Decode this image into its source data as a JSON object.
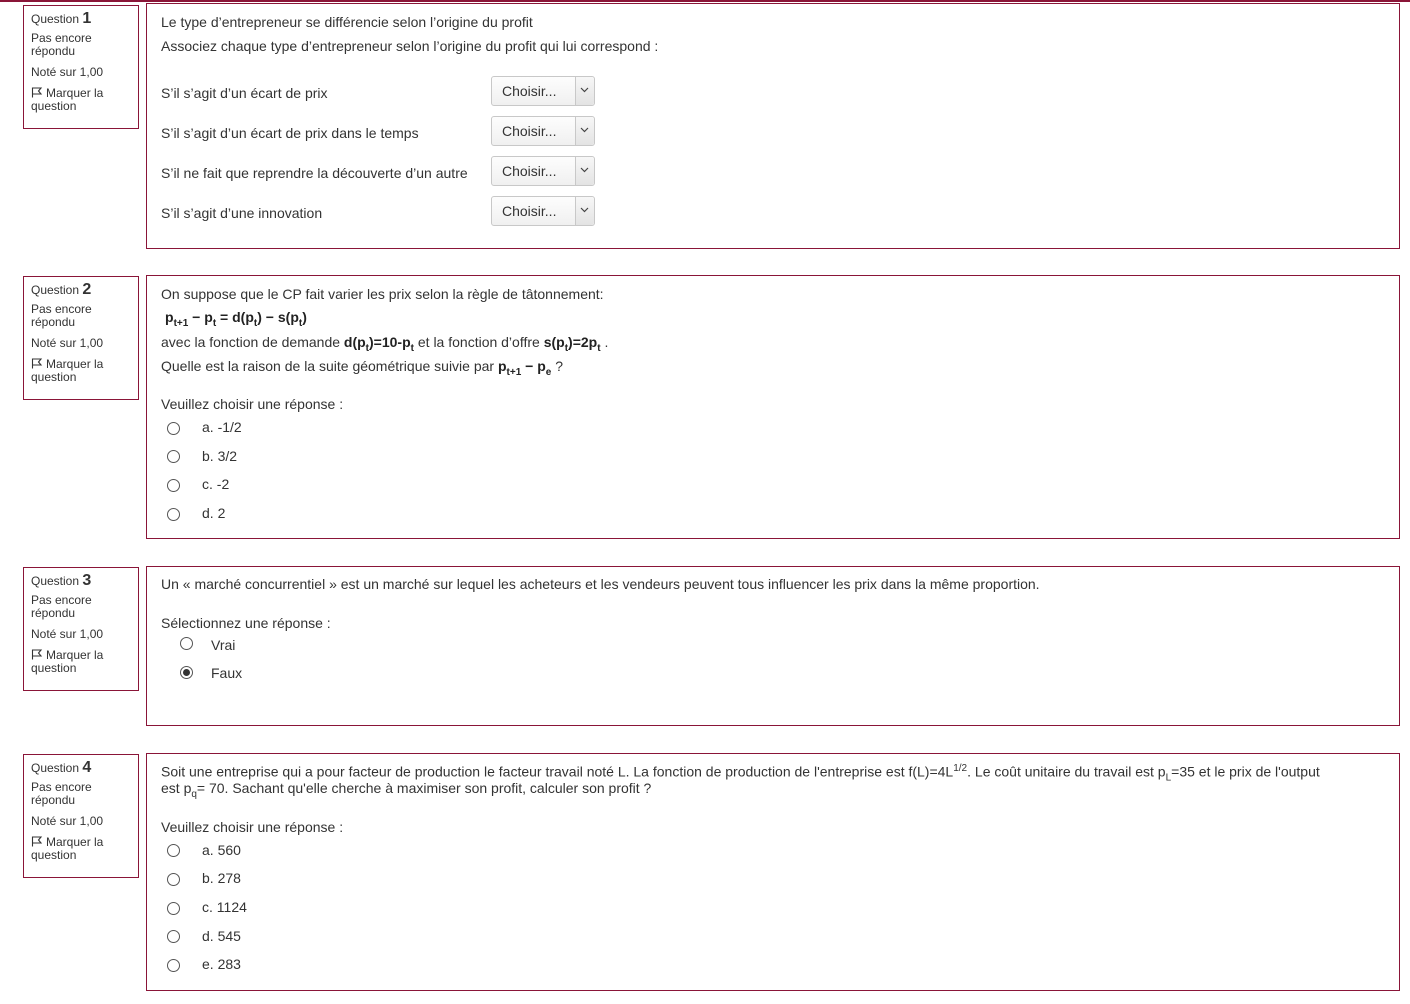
{
  "questions": [
    {
      "label": "Question",
      "number": "1",
      "state": "Pas encore répondu",
      "grade": "Noté sur 1,00",
      "flag_label": "Marquer la question",
      "title": "Le type d’entrepreneur se différencie selon l’origine du profit",
      "prompt": "Associez chaque type d’entrepreneur selon l’origine du profit qui lui correspond :",
      "rows": [
        {
          "label": "S’il s’agit d’un écart de prix",
          "select_value": "Choisir..."
        },
        {
          "label": "S’il s’agit d’un écart de prix dans le temps",
          "select_value": "Choisir..."
        },
        {
          "label": "S’il ne fait que reprendre la découverte d’un autre",
          "select_value": "Choisir..."
        },
        {
          "label": "S’il s’agit d’une innovation",
          "select_value": "Choisir..."
        }
      ]
    },
    {
      "label": "Question",
      "number": "2",
      "state": "Pas encore répondu",
      "grade": "Noté sur 1,00",
      "flag_label": "Marquer la question",
      "intro": "On suppose que le CP fait varier les prix selon la règle de tâtonnement:",
      "formula": {
        "p": "p",
        "t1": "t+1",
        "minus": " − ",
        "t": "t",
        "eq": " = d(p",
        "close": ") − s(p",
        "end": ")"
      },
      "line2": {
        "a": "avec la fonction de demande ",
        "demand": "d(p",
        "demand_end": ")=10-p",
        "b": " et la fonction d’offre ",
        "supply": "s(p",
        "supply_end": ")=2p",
        "c": " ."
      },
      "line3": {
        "a": "Quelle est la raison de la suite géométrique suivie par ",
        "p1": "p",
        "t1": "t+1",
        "minus": " − p",
        "e": "e",
        "c": " ?"
      },
      "instruction": "Veuillez choisir une réponse :",
      "options": [
        "a. -1/2",
        "b. 3/2",
        "c. -2",
        "d. 2"
      ]
    },
    {
      "label": "Question",
      "number": "3",
      "state": "Pas encore répondu",
      "grade": "Noté sur 1,00",
      "flag_label": "Marquer la question",
      "text": "Un « marché concurrentiel » est un marché sur lequel les acheteurs et les vendeurs peuvent tous influencer les prix dans la même proportion.",
      "instruction": "Sélectionnez une réponse :",
      "options": [
        "Vrai",
        "Faux"
      ],
      "selected": "Faux"
    },
    {
      "label": "Question",
      "number": "4",
      "state": "Pas encore répondu",
      "grade": "Noté sur 1,00",
      "flag_label": "Marquer la question",
      "text": {
        "a": "Soit une entreprise qui a pour facteur de production le facteur travail noté L. La fonction de production de l'entreprise est f(L)=4L",
        "exp": "1/2",
        "b": ". Le coût unitaire du travail est p",
        "sub_l": "L",
        "c": "=35 et le prix de l'output",
        "d": "est p",
        "sub_q": "q",
        "e": "= 70. Sachant qu'elle cherche à maximiser son profit, calculer son profit ?"
      },
      "instruction": "Veuillez choisir une réponse :",
      "options": [
        "a. 560",
        "b. 278",
        "c. 1124",
        "d. 545",
        "e. 283"
      ]
    }
  ],
  "colors": {
    "accent": "#8a1538",
    "text": "#333333"
  },
  "icons": {
    "flag": "flag-icon",
    "select_arrow": "chevron-down-icon",
    "radio": "radio-icon"
  }
}
